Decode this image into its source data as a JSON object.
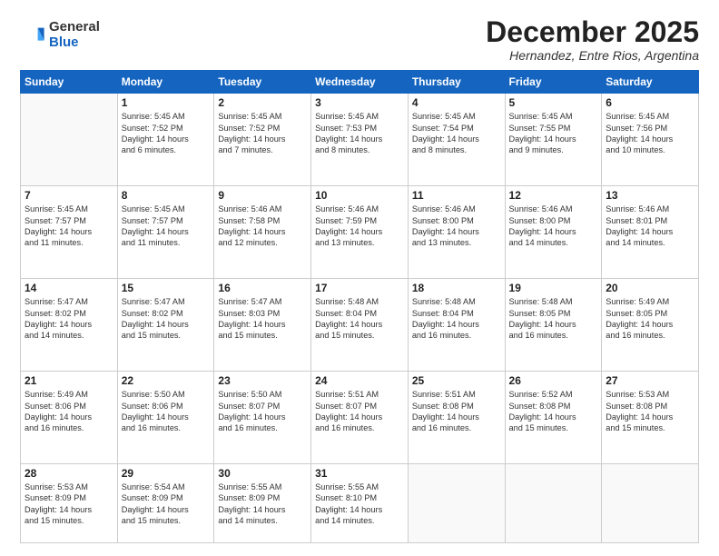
{
  "logo": {
    "general": "General",
    "blue": "Blue"
  },
  "header": {
    "month": "December 2025",
    "location": "Hernandez, Entre Rios, Argentina"
  },
  "days_of_week": [
    "Sunday",
    "Monday",
    "Tuesday",
    "Wednesday",
    "Thursday",
    "Friday",
    "Saturday"
  ],
  "weeks": [
    [
      {
        "day": "",
        "content": ""
      },
      {
        "day": "1",
        "content": "Sunrise: 5:45 AM\nSunset: 7:52 PM\nDaylight: 14 hours\nand 6 minutes."
      },
      {
        "day": "2",
        "content": "Sunrise: 5:45 AM\nSunset: 7:52 PM\nDaylight: 14 hours\nand 7 minutes."
      },
      {
        "day": "3",
        "content": "Sunrise: 5:45 AM\nSunset: 7:53 PM\nDaylight: 14 hours\nand 8 minutes."
      },
      {
        "day": "4",
        "content": "Sunrise: 5:45 AM\nSunset: 7:54 PM\nDaylight: 14 hours\nand 8 minutes."
      },
      {
        "day": "5",
        "content": "Sunrise: 5:45 AM\nSunset: 7:55 PM\nDaylight: 14 hours\nand 9 minutes."
      },
      {
        "day": "6",
        "content": "Sunrise: 5:45 AM\nSunset: 7:56 PM\nDaylight: 14 hours\nand 10 minutes."
      }
    ],
    [
      {
        "day": "7",
        "content": "Sunrise: 5:45 AM\nSunset: 7:57 PM\nDaylight: 14 hours\nand 11 minutes."
      },
      {
        "day": "8",
        "content": "Sunrise: 5:45 AM\nSunset: 7:57 PM\nDaylight: 14 hours\nand 11 minutes."
      },
      {
        "day": "9",
        "content": "Sunrise: 5:46 AM\nSunset: 7:58 PM\nDaylight: 14 hours\nand 12 minutes."
      },
      {
        "day": "10",
        "content": "Sunrise: 5:46 AM\nSunset: 7:59 PM\nDaylight: 14 hours\nand 13 minutes."
      },
      {
        "day": "11",
        "content": "Sunrise: 5:46 AM\nSunset: 8:00 PM\nDaylight: 14 hours\nand 13 minutes."
      },
      {
        "day": "12",
        "content": "Sunrise: 5:46 AM\nSunset: 8:00 PM\nDaylight: 14 hours\nand 14 minutes."
      },
      {
        "day": "13",
        "content": "Sunrise: 5:46 AM\nSunset: 8:01 PM\nDaylight: 14 hours\nand 14 minutes."
      }
    ],
    [
      {
        "day": "14",
        "content": "Sunrise: 5:47 AM\nSunset: 8:02 PM\nDaylight: 14 hours\nand 14 minutes."
      },
      {
        "day": "15",
        "content": "Sunrise: 5:47 AM\nSunset: 8:02 PM\nDaylight: 14 hours\nand 15 minutes."
      },
      {
        "day": "16",
        "content": "Sunrise: 5:47 AM\nSunset: 8:03 PM\nDaylight: 14 hours\nand 15 minutes."
      },
      {
        "day": "17",
        "content": "Sunrise: 5:48 AM\nSunset: 8:04 PM\nDaylight: 14 hours\nand 15 minutes."
      },
      {
        "day": "18",
        "content": "Sunrise: 5:48 AM\nSunset: 8:04 PM\nDaylight: 14 hours\nand 16 minutes."
      },
      {
        "day": "19",
        "content": "Sunrise: 5:48 AM\nSunset: 8:05 PM\nDaylight: 14 hours\nand 16 minutes."
      },
      {
        "day": "20",
        "content": "Sunrise: 5:49 AM\nSunset: 8:05 PM\nDaylight: 14 hours\nand 16 minutes."
      }
    ],
    [
      {
        "day": "21",
        "content": "Sunrise: 5:49 AM\nSunset: 8:06 PM\nDaylight: 14 hours\nand 16 minutes."
      },
      {
        "day": "22",
        "content": "Sunrise: 5:50 AM\nSunset: 8:06 PM\nDaylight: 14 hours\nand 16 minutes."
      },
      {
        "day": "23",
        "content": "Sunrise: 5:50 AM\nSunset: 8:07 PM\nDaylight: 14 hours\nand 16 minutes."
      },
      {
        "day": "24",
        "content": "Sunrise: 5:51 AM\nSunset: 8:07 PM\nDaylight: 14 hours\nand 16 minutes."
      },
      {
        "day": "25",
        "content": "Sunrise: 5:51 AM\nSunset: 8:08 PM\nDaylight: 14 hours\nand 16 minutes."
      },
      {
        "day": "26",
        "content": "Sunrise: 5:52 AM\nSunset: 8:08 PM\nDaylight: 14 hours\nand 15 minutes."
      },
      {
        "day": "27",
        "content": "Sunrise: 5:53 AM\nSunset: 8:08 PM\nDaylight: 14 hours\nand 15 minutes."
      }
    ],
    [
      {
        "day": "28",
        "content": "Sunrise: 5:53 AM\nSunset: 8:09 PM\nDaylight: 14 hours\nand 15 minutes."
      },
      {
        "day": "29",
        "content": "Sunrise: 5:54 AM\nSunset: 8:09 PM\nDaylight: 14 hours\nand 15 minutes."
      },
      {
        "day": "30",
        "content": "Sunrise: 5:55 AM\nSunset: 8:09 PM\nDaylight: 14 hours\nand 14 minutes."
      },
      {
        "day": "31",
        "content": "Sunrise: 5:55 AM\nSunset: 8:10 PM\nDaylight: 14 hours\nand 14 minutes."
      },
      {
        "day": "",
        "content": ""
      },
      {
        "day": "",
        "content": ""
      },
      {
        "day": "",
        "content": ""
      }
    ]
  ]
}
